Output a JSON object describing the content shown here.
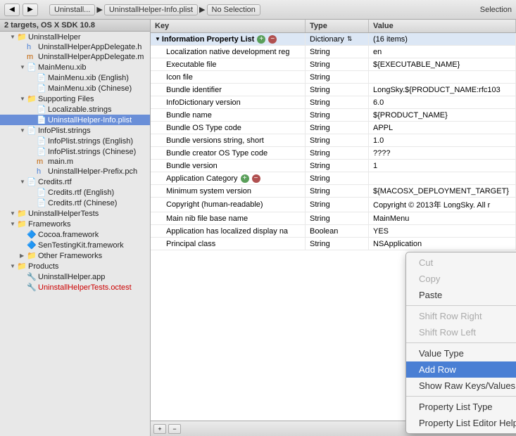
{
  "toolbar": {
    "breadcrumbs": [
      "Uninstall...",
      "UninstallHelper-Info.plist",
      "No Selection"
    ],
    "selection_label": "Selection"
  },
  "sidebar": {
    "header": "2 targets, OS X SDK 10.8",
    "items": [
      {
        "id": "uninstallhelper-group",
        "label": "UninstallHelper",
        "indent": 0,
        "type": "group",
        "expanded": true
      },
      {
        "id": "appdelegate-h",
        "label": "UninstallHelperAppDelegate.h",
        "indent": 2,
        "type": "h-file"
      },
      {
        "id": "appdelegate-m",
        "label": "UninstallHelperAppDelegate.m",
        "indent": 2,
        "type": "m-file"
      },
      {
        "id": "mainmenu-xib",
        "label": "MainMenu.xib",
        "indent": 1,
        "type": "xib",
        "expanded": true
      },
      {
        "id": "mainmenu-en",
        "label": "MainMenu.xib (English)",
        "indent": 2,
        "type": "xib"
      },
      {
        "id": "mainmenu-zh",
        "label": "MainMenu.xib (Chinese)",
        "indent": 2,
        "type": "xib"
      },
      {
        "id": "supporting-files",
        "label": "Supporting Files",
        "indent": 1,
        "type": "group",
        "expanded": true
      },
      {
        "id": "localizable",
        "label": "Localizable.strings",
        "indent": 2,
        "type": "strings"
      },
      {
        "id": "infoplist",
        "label": "UninstallHelper-Info.plist",
        "indent": 2,
        "type": "plist",
        "selected": true
      },
      {
        "id": "infoplist-strings",
        "label": "InfoPlist.strings",
        "indent": 1,
        "type": "strings-group",
        "expanded": true
      },
      {
        "id": "infoplist-en",
        "label": "InfoPlist.strings (English)",
        "indent": 2,
        "type": "strings"
      },
      {
        "id": "infoplist-zh",
        "label": "InfoPlist.strings (Chinese)",
        "indent": 2,
        "type": "strings"
      },
      {
        "id": "main-m",
        "label": "main.m",
        "indent": 2,
        "type": "m-file"
      },
      {
        "id": "prefix-pch",
        "label": "UninstallHelper-Prefix.pch",
        "indent": 2,
        "type": "h-file"
      },
      {
        "id": "credits-rtf",
        "label": "Credits.rtf",
        "indent": 1,
        "type": "rtf",
        "expanded": true
      },
      {
        "id": "credits-en",
        "label": "Credits.rtf (English)",
        "indent": 2,
        "type": "rtf"
      },
      {
        "id": "credits-zh",
        "label": "Credits.rtf (Chinese)",
        "indent": 2,
        "type": "rtf"
      },
      {
        "id": "uninstallhelpertests",
        "label": "UninstallHelperTests",
        "indent": 0,
        "type": "group",
        "expanded": true
      },
      {
        "id": "frameworks",
        "label": "Frameworks",
        "indent": 0,
        "type": "group",
        "expanded": true
      },
      {
        "id": "cocoa",
        "label": "Cocoa.framework",
        "indent": 1,
        "type": "framework"
      },
      {
        "id": "sentestingkit",
        "label": "SenTestingKit.framework",
        "indent": 1,
        "type": "framework"
      },
      {
        "id": "other-frameworks",
        "label": "Other Frameworks",
        "indent": 1,
        "type": "group"
      },
      {
        "id": "products",
        "label": "Products",
        "indent": 0,
        "type": "group",
        "expanded": true
      },
      {
        "id": "uninstallhelper-app",
        "label": "UninstallHelper.app",
        "indent": 1,
        "type": "app"
      },
      {
        "id": "uninstallhelpertests-octest",
        "label": "UninstallHelperTests.octest",
        "indent": 1,
        "type": "octest",
        "error": true
      }
    ]
  },
  "plist_table": {
    "columns": [
      "Key",
      "Type",
      "Value"
    ],
    "rows": [
      {
        "key": "Information Property List",
        "type": "Dictionary",
        "value": "(16 items)",
        "indent": 0,
        "root": true,
        "expanded": true
      },
      {
        "key": "Localization native development reg",
        "type": "String",
        "value": "en",
        "indent": 1
      },
      {
        "key": "Executable file",
        "type": "String",
        "value": "${EXECUTABLE_NAME}",
        "indent": 1
      },
      {
        "key": "Icon file",
        "type": "String",
        "value": "",
        "indent": 1
      },
      {
        "key": "Bundle identifier",
        "type": "String",
        "value": "LongSky.${PRODUCT_NAME:rfc103",
        "indent": 1
      },
      {
        "key": "InfoDictionary version",
        "type": "String",
        "value": "6.0",
        "indent": 1
      },
      {
        "key": "Bundle name",
        "type": "String",
        "value": "${PRODUCT_NAME}",
        "indent": 1
      },
      {
        "key": "Bundle OS Type code",
        "type": "String",
        "value": "APPL",
        "indent": 1
      },
      {
        "key": "Bundle versions string, short",
        "type": "String",
        "value": "1.0",
        "indent": 1
      },
      {
        "key": "Bundle creator OS Type code",
        "type": "String",
        "value": "????",
        "indent": 1
      },
      {
        "key": "Bundle version",
        "type": "String",
        "value": "1",
        "indent": 1
      },
      {
        "key": "Application Category",
        "type": "String",
        "value": "",
        "indent": 1
      },
      {
        "key": "Minimum system version",
        "type": "String",
        "value": "${MACOSX_DEPLOYMENT_TARGET}",
        "indent": 1
      },
      {
        "key": "Copyright (human-readable)",
        "type": "String",
        "value": "Copyright © 2013年 LongSky. All r",
        "indent": 1
      },
      {
        "key": "Main nib file base name",
        "type": "String",
        "value": "MainMenu",
        "indent": 1
      },
      {
        "key": "Application has localized display na",
        "type": "Boolean",
        "value": "YES",
        "indent": 1
      },
      {
        "key": "Principal class",
        "type": "String",
        "value": "NSApplication",
        "indent": 1
      }
    ]
  },
  "context_menu": {
    "items": [
      {
        "id": "cut",
        "label": "Cut",
        "disabled": true
      },
      {
        "id": "copy",
        "label": "Copy",
        "disabled": true
      },
      {
        "id": "paste",
        "label": "Paste",
        "disabled": false
      },
      {
        "id": "sep1",
        "type": "separator"
      },
      {
        "id": "shift-right",
        "label": "Shift Row Right",
        "disabled": true
      },
      {
        "id": "shift-left",
        "label": "Shift Row Left",
        "disabled": true
      },
      {
        "id": "sep2",
        "type": "separator"
      },
      {
        "id": "value-type",
        "label": "Value Type",
        "has_arrow": true
      },
      {
        "id": "add-row",
        "label": "Add Row",
        "highlighted": true
      },
      {
        "id": "show-raw",
        "label": "Show Raw Keys/Values"
      },
      {
        "id": "sep3",
        "type": "separator"
      },
      {
        "id": "prop-list-type",
        "label": "Property List Type",
        "has_arrow": true
      },
      {
        "id": "prop-list-help",
        "label": "Property List Editor Help",
        "has_arrow": true
      }
    ]
  },
  "bottom_toolbar": {
    "buttons": [
      "+",
      "-",
      "◀",
      "▶",
      "⏸",
      "▶▶"
    ]
  }
}
